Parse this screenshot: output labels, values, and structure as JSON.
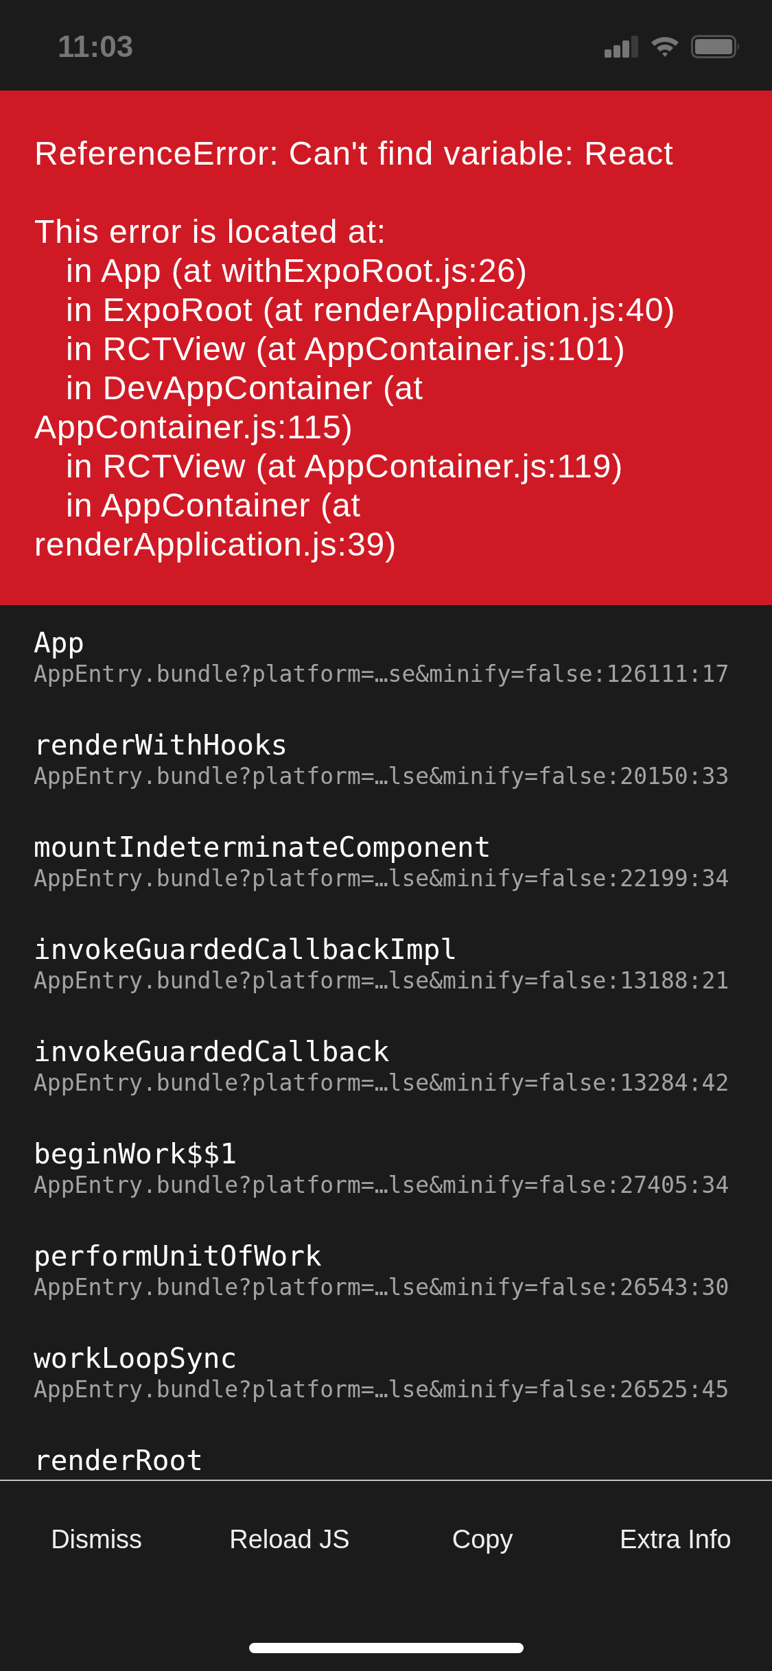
{
  "status_bar": {
    "time": "11:03"
  },
  "error": {
    "title": "ReferenceError: Can't find variable: React",
    "location_heading": "This error is located at:",
    "component_stack": [
      "in App (at withExpoRoot.js:26)",
      "in ExpoRoot (at renderApplication.js:40)",
      "in RCTView (at AppContainer.js:101)",
      "in DevAppContainer (at AppContainer.js:115)",
      "in RCTView (at AppContainer.js:119)",
      "in AppContainer (at renderApplication.js:39)"
    ]
  },
  "stack_frames": [
    {
      "method": "App",
      "location": "AppEntry.bundle?platform=…se&minify=false:126111:17"
    },
    {
      "method": "renderWithHooks",
      "location": "AppEntry.bundle?platform=…lse&minify=false:20150:33"
    },
    {
      "method": "mountIndeterminateComponent",
      "location": "AppEntry.bundle?platform=…lse&minify=false:22199:34"
    },
    {
      "method": "invokeGuardedCallbackImpl",
      "location": "AppEntry.bundle?platform=…lse&minify=false:13188:21"
    },
    {
      "method": "invokeGuardedCallback",
      "location": "AppEntry.bundle?platform=…lse&minify=false:13284:42"
    },
    {
      "method": "beginWork$$1",
      "location": "AppEntry.bundle?platform=…lse&minify=false:27405:34"
    },
    {
      "method": "performUnitOfWork",
      "location": "AppEntry.bundle?platform=…lse&minify=false:26543:30"
    },
    {
      "method": "workLoopSync",
      "location": "AppEntry.bundle?platform=…lse&minify=false:26525:45"
    },
    {
      "method": "renderRoot"
    }
  ],
  "buttons": [
    {
      "label": "Dismiss"
    },
    {
      "label": "Reload JS"
    },
    {
      "label": "Copy"
    },
    {
      "label": "Extra Info"
    }
  ]
}
